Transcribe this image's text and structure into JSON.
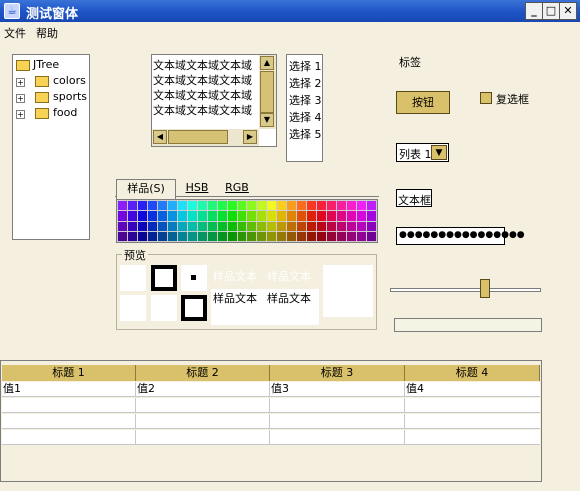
{
  "window": {
    "title": "测试窗体",
    "minimize": "_",
    "maximize": "□",
    "close": "✕"
  },
  "menu": [
    "文件",
    "帮助"
  ],
  "tree": {
    "root": "JTree",
    "children": [
      "colors",
      "sports",
      "food"
    ]
  },
  "textarea": {
    "lines": [
      "文本域文本域文本域",
      "文本域文本域文本域",
      "文本域文本域文本域",
      "文本域文本域文本域"
    ]
  },
  "list": [
    "选择 1",
    "选择 2",
    "选择 3",
    "选择 4",
    "选择 5"
  ],
  "label": "标签",
  "button": "按钮",
  "checkbox": "复选框",
  "combo": {
    "value": "列表 1",
    "arrow": "▼"
  },
  "textfield": "文本框",
  "password": "●●●●●●●●●●●●●●●●",
  "colorchooser": {
    "tabs": [
      "样品(S)",
      "HSB",
      "RGB"
    ],
    "preview_title": "预览",
    "sample_text": "样品文本"
  },
  "table": {
    "headers": [
      "标题 1",
      "标题 2",
      "标题 3",
      "标题 4"
    ],
    "rows": [
      [
        "值1",
        "值2",
        "值3",
        "值4"
      ],
      [
        "",
        "",
        "",
        ""
      ],
      [
        "",
        "",
        "",
        ""
      ],
      [
        "",
        "",
        "",
        ""
      ]
    ]
  },
  "colors": {
    "titlebar": "#1f55c8",
    "gold": "#d9c06a",
    "panel": "#f4efdf"
  }
}
